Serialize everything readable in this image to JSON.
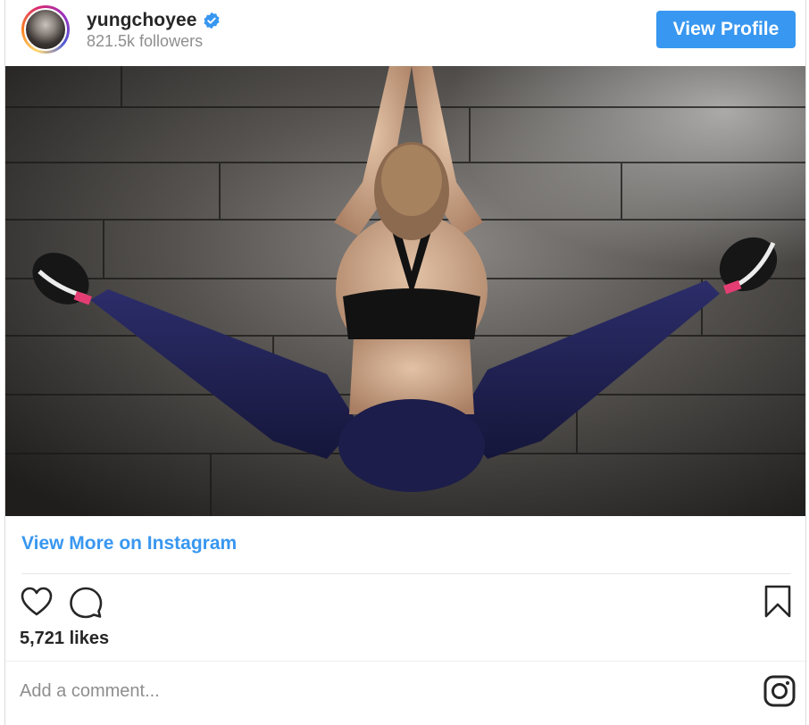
{
  "header": {
    "username": "yungchoyee",
    "verified": true,
    "followers": "821.5k followers",
    "view_profile_label": "View Profile"
  },
  "post": {
    "image_icon": "post-photo",
    "view_more_label": "View More on Instagram",
    "likes": "5,721 likes"
  },
  "actions": {
    "like_icon": "heart-outline-icon",
    "comment_icon": "comment-bubble-icon",
    "save_icon": "bookmark-outline-icon"
  },
  "comment": {
    "placeholder": "Add a comment..."
  },
  "colors": {
    "accent": "#3897f0",
    "text": "#262626",
    "muted": "#8e8e8e"
  }
}
